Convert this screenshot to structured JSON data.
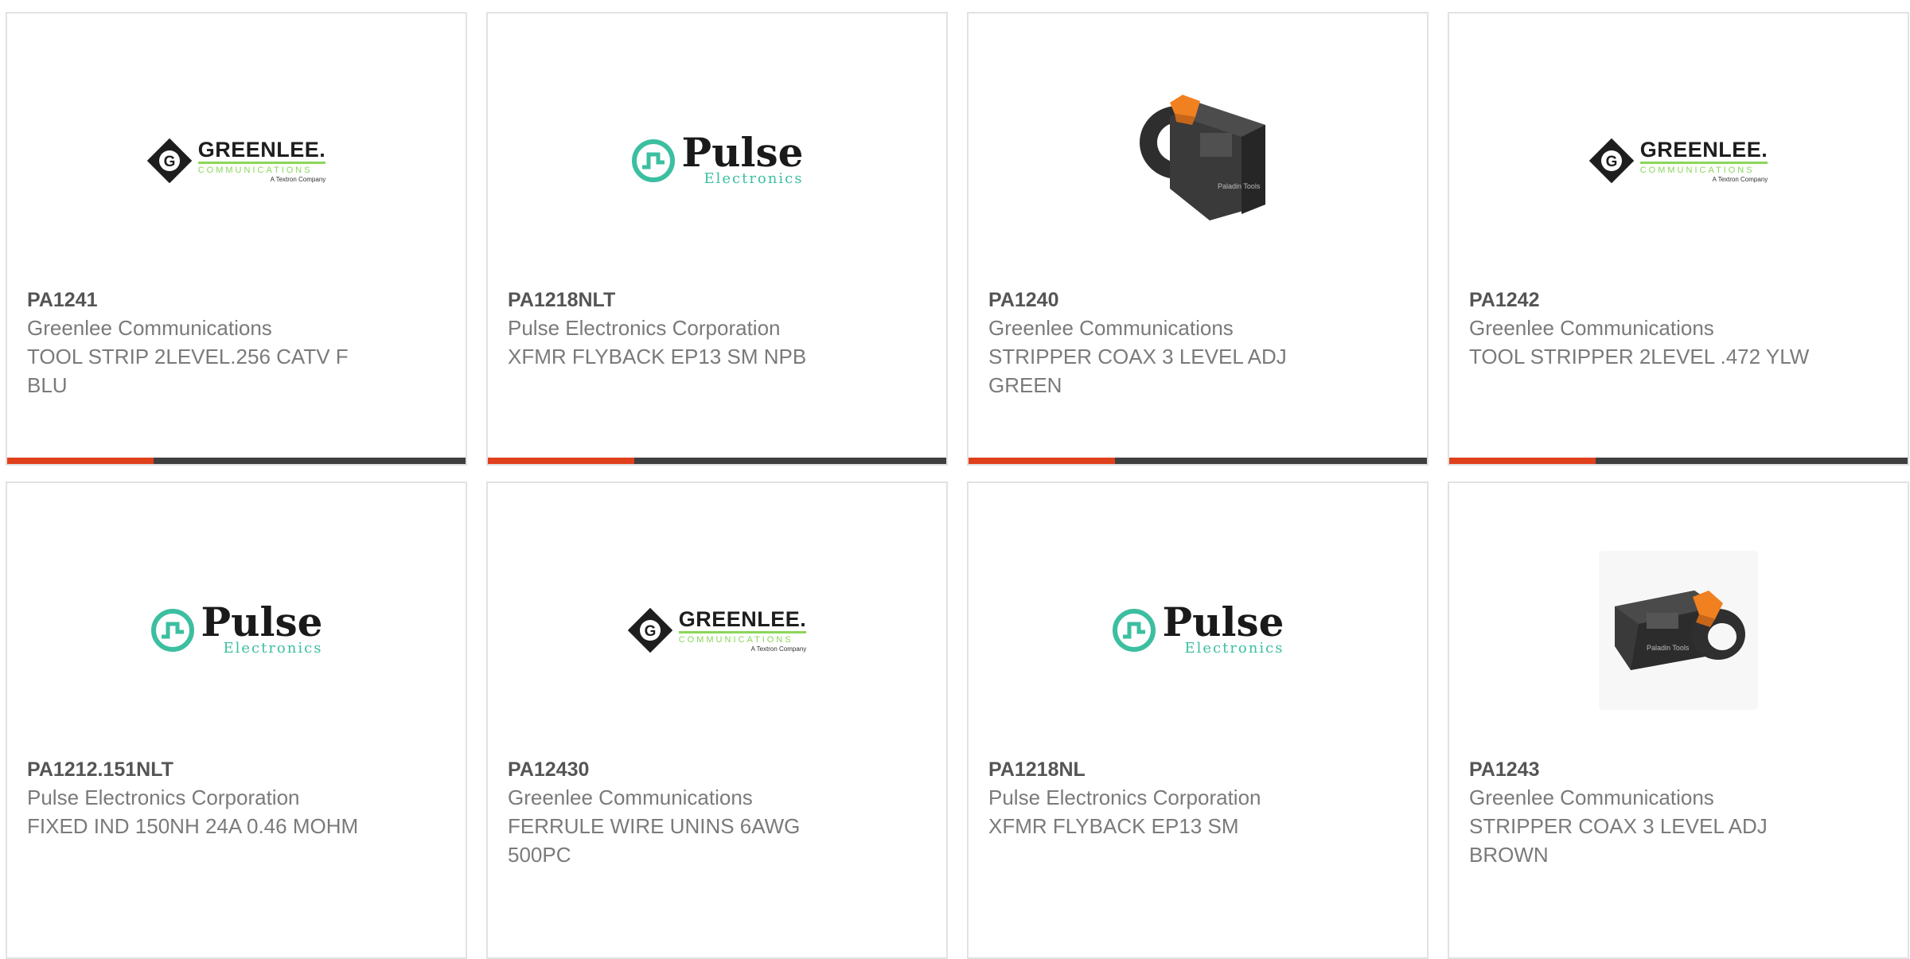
{
  "products": [
    {
      "part": "PA1241",
      "manufacturer": "Greenlee Communications",
      "description": "TOOL STRIP 2LEVEL.256 CATV F BLU",
      "image": "greenlee-logo"
    },
    {
      "part": "PA1218NLT",
      "manufacturer": "Pulse Electronics Corporation",
      "description": "XFMR FLYBACK EP13 SM NPB",
      "image": "pulse-logo"
    },
    {
      "part": "PA1240",
      "manufacturer": "Greenlee Communications",
      "description": "STRIPPER COAX 3 LEVEL ADJ GREEN",
      "image": "coax-stripper-photo"
    },
    {
      "part": "PA1242",
      "manufacturer": "Greenlee Communications",
      "description": "TOOL STRIPPER 2LEVEL .472 YLW",
      "image": "greenlee-logo"
    },
    {
      "part": "PA1212.151NLT",
      "manufacturer": "Pulse Electronics Corporation",
      "description": "FIXED IND 150NH 24A 0.46 MOHM",
      "image": "pulse-logo"
    },
    {
      "part": "PA12430",
      "manufacturer": "Greenlee Communications",
      "description": "FERRULE WIRE UNINS 6AWG 500PC",
      "image": "greenlee-logo"
    },
    {
      "part": "PA1218NL",
      "manufacturer": "Pulse Electronics Corporation",
      "description": "XFMR FLYBACK EP13 SM",
      "image": "pulse-logo"
    },
    {
      "part": "PA1243",
      "manufacturer": "Greenlee Communications",
      "description": "STRIPPER COAX 3 LEVEL ADJ BROWN",
      "image": "coax-stripper-photo"
    }
  ],
  "logos": {
    "greenlee": {
      "word": "GREENLEE.",
      "sub": "COMMUNICATIONS",
      "tag": "A Textron Company"
    },
    "pulse": {
      "word": "Pulse",
      "sub": "Electronics"
    }
  },
  "colors": {
    "accent": "#e0401c",
    "bar": "#3f3f3f",
    "text_primary": "#555555",
    "text_secondary": "#7a7a7a",
    "greenlee_green": "#8bd65a",
    "pulse_teal": "#3cbfa0"
  }
}
